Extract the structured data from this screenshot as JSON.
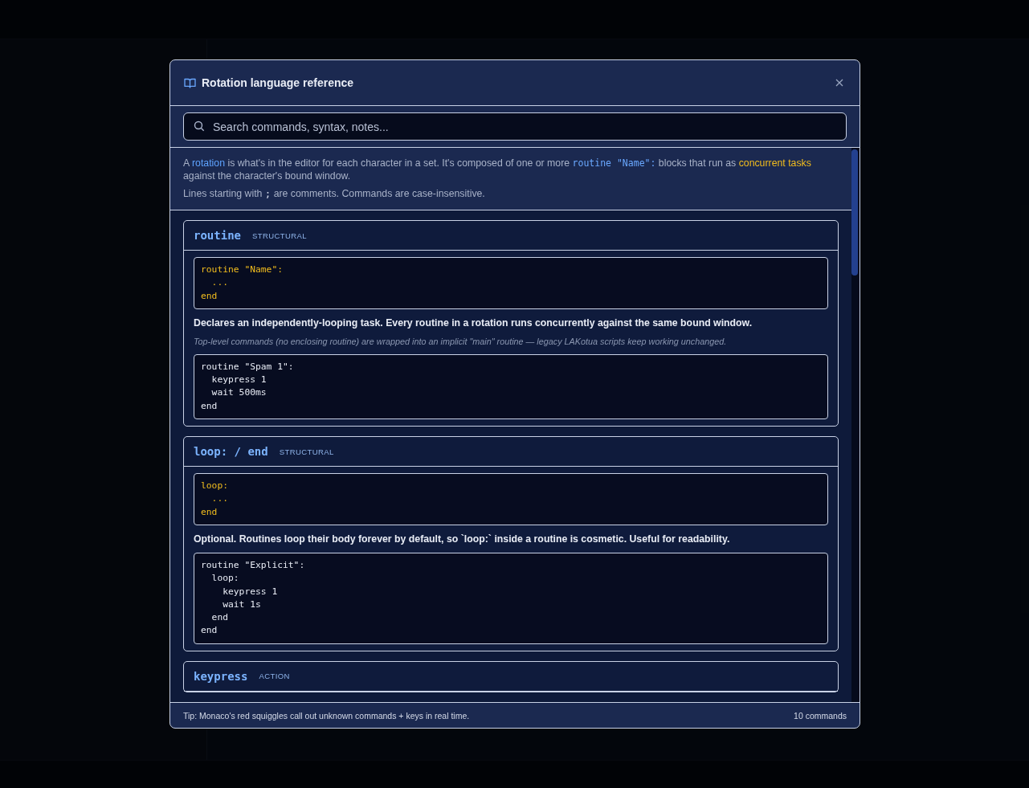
{
  "modal": {
    "title": "Rotation language reference",
    "search": {
      "placeholder": "Search commands, syntax, notes..."
    },
    "intro": [
      [
        {
          "kind": "text",
          "text": "A "
        },
        {
          "kind": "term",
          "text": "rotation"
        },
        {
          "kind": "text",
          "text": " is what's in the editor for each character in a set. It's composed of one or more "
        },
        {
          "kind": "code",
          "text": "routine \"Name\":"
        },
        {
          "kind": "text",
          "text": " blocks that run as "
        },
        {
          "kind": "highlight",
          "text": "concurrent tasks"
        },
        {
          "kind": "text",
          "text": " against the character's bound window."
        }
      ],
      [
        {
          "kind": "text",
          "text": "Lines starting with "
        },
        {
          "kind": "code-plain",
          "text": ";"
        },
        {
          "kind": "text",
          "text": " are comments. Commands are case-insensitive."
        }
      ]
    ],
    "commands": [
      {
        "name": "routine",
        "category": "STRUCTURAL",
        "syntax": "routine \"Name\":\n  ...\nend",
        "description": "Declares an independently-looping task. Every routine in a rotation runs concurrently against the same bound window.",
        "note": "Top-level commands (no enclosing routine) are wrapped into an implicit \"main\" routine — legacy LAKotua scripts keep working unchanged.",
        "example": "routine \"Spam 1\":\n  keypress 1\n  wait 500ms\nend"
      },
      {
        "name": "loop: / end",
        "category": "STRUCTURAL",
        "syntax": "loop:\n  ...\nend",
        "description": "Optional. Routines loop their body forever by default, so `loop:` inside a routine is cosmetic. Useful for readability.",
        "example": "routine \"Explicit\":\n  loop:\n    keypress 1\n    wait 1s\n  end\nend"
      },
      {
        "name": "keypress",
        "category": "ACTION"
      }
    ],
    "footer": {
      "tip": "Tip: Monaco's red squiggles call out unknown commands + keys in real time.",
      "count": "10 commands"
    }
  }
}
